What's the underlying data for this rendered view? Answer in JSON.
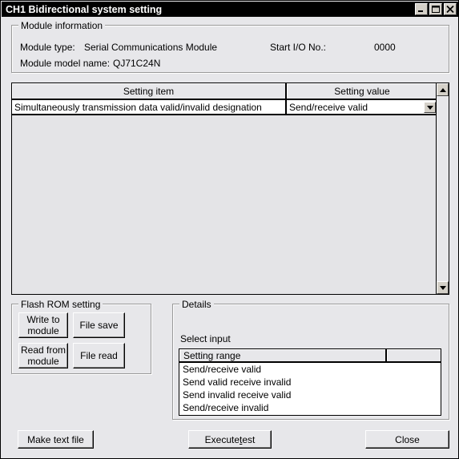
{
  "window": {
    "title": "CH1 Bidirectional system setting",
    "controls": [
      {
        "name": "minimize-button",
        "label": "_"
      },
      {
        "name": "maximize-button",
        "label": "□"
      },
      {
        "name": "close-button",
        "label": "✕"
      }
    ]
  },
  "module_information": {
    "group_title": "Module information",
    "module_type_label": "Module type:",
    "module_type_value": "Serial Communications Module",
    "start_io_label": "Start I/O No.:",
    "start_io_value": "0000",
    "module_model_label": "Module model name:",
    "module_model_value": "QJ71C24N"
  },
  "settings_table": {
    "columns": [
      "Setting item",
      "Setting value"
    ],
    "rows": [
      {
        "item": "Simultaneously transmission data valid/invalid designation",
        "value": "Send/receive valid"
      }
    ],
    "scrollbar": {
      "up_arrow": "▲",
      "down_arrow": "▼"
    },
    "combo_arrow": "▼"
  },
  "flash_rom": {
    "group_title": "Flash ROM setting",
    "buttons": [
      {
        "name": "write-to-module-button",
        "label": "Write to\nmodule"
      },
      {
        "name": "file-save-button",
        "label": "File save"
      },
      {
        "name": "read-from-module-button",
        "label": "Read from\nmodule"
      },
      {
        "name": "file-read-button",
        "label": "File read"
      }
    ]
  },
  "details": {
    "group_title": "Details",
    "select_input_label": "Select input",
    "columns": [
      "Setting range",
      ""
    ],
    "rows": [
      "Send/receive valid",
      "Send valid receive invalid",
      "Send invalid receive valid",
      "Send/receive invalid"
    ]
  },
  "footer": {
    "make_text_file": "Make text file",
    "execute_test_pre": "Execute ",
    "execute_test_accel": "t",
    "execute_test_post": "est",
    "close": "Close"
  },
  "colors": {
    "window_bg": "#e7e7ea",
    "titlebar_bg": "#000000",
    "titlebar_fg": "#ffffff",
    "field_bg": "#ffffff",
    "button_face": "#e7e7ea",
    "list_empty_bg": "#e4e4e7"
  }
}
